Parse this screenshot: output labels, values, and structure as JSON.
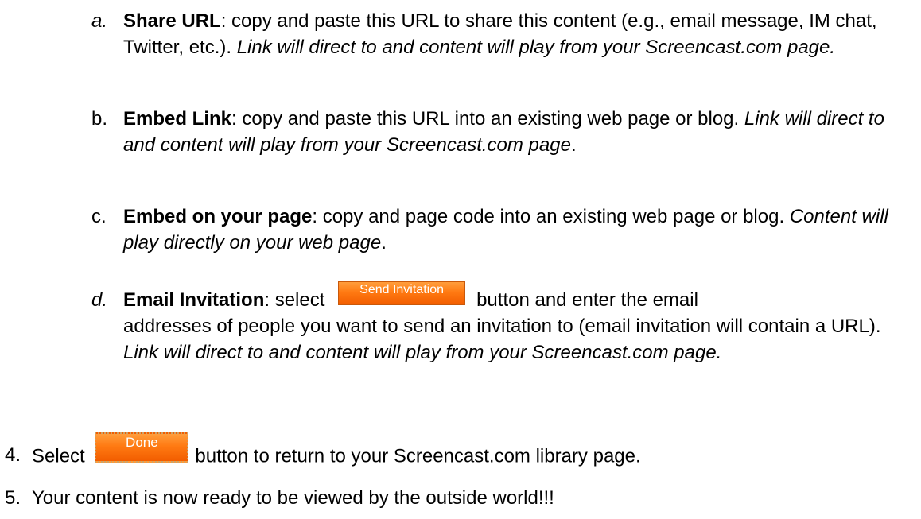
{
  "items": {
    "a": {
      "marker": "a.",
      "term": "Share URL",
      "text": ": copy and paste this URL to share this content (e.g., email message, IM chat, Twitter, etc.).",
      "note": "Link will direct to and content will play from your Screencast.com page."
    },
    "b": {
      "marker": "b.",
      "term": "Embed Link",
      "text": ": copy and paste this URL into an existing web page or blog.",
      "note": "Link will direct to and content will play from your Screencast.com page",
      "end": "."
    },
    "c": {
      "marker": "c.",
      "term": "Embed on your page",
      "text": ": copy and page code into an existing web page or blog.",
      "note": "Content will play directly on your web page",
      "end": "."
    },
    "d": {
      "marker": "d.",
      "term": "Email Invitation",
      "pre": ": select",
      "button": "Send Invitation",
      "post": "button and enter the email addresses of people you want to send an invitation to (email invitation will contain a URL).",
      "note": "Link will direct to and content will play from your Screencast.com page."
    }
  },
  "step4": {
    "marker": "4.",
    "pre": "Select",
    "button": "Done",
    "post": "button to return to your Screencast.com library page."
  },
  "step5": {
    "marker": "5.",
    "text": "Your content is now ready to be viewed by the outside world!!!"
  },
  "colors": {
    "button_orange": "#ff7a12",
    "text": "#000000"
  }
}
